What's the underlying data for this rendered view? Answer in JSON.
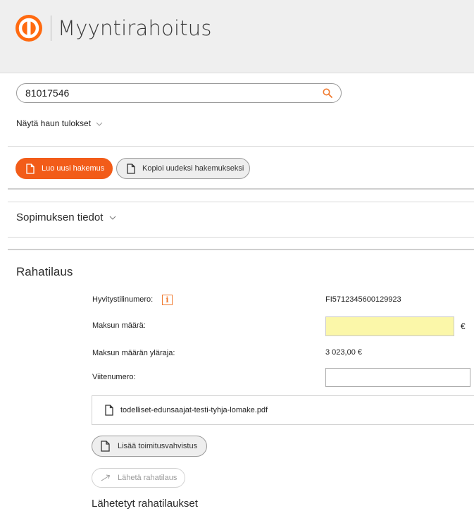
{
  "header": {
    "app_title": "Myyntirahoitus"
  },
  "search": {
    "value": "81017546",
    "placeholder": ""
  },
  "results": {
    "toggle_label": "Näytä haun tulokset"
  },
  "actions": {
    "new_application": "Luo uusi hakemus",
    "copy_application": "Kopioi uudeksi hakemukseksi"
  },
  "contract": {
    "label": "Sopimuksen tiedot"
  },
  "payment_order": {
    "title": "Rahatilaus",
    "refund_account_label": "Hyvitystilinumero:",
    "refund_account_value": "FI5712345600129923",
    "amount_label": "Maksun määrä:",
    "amount_value": "",
    "currency": "€",
    "max_amount_label": "Maksun määrän yläraja:",
    "max_amount_value": "3 023,00 €",
    "reference_label": "Viitenumero:",
    "reference_value": "",
    "attachment_name": "todelliset-edunsaajat-testi-tyhja-lomake.pdf",
    "add_confirmation": "Lisää toimitusvahvistus",
    "send": "Lähetä rahatilaus"
  },
  "sent_orders": {
    "title": "Lähetetyt rahatilaukset"
  },
  "colors": {
    "accent": "#f25c19",
    "highlight_input": "#fbf7a9",
    "header_bg": "#efefef"
  }
}
